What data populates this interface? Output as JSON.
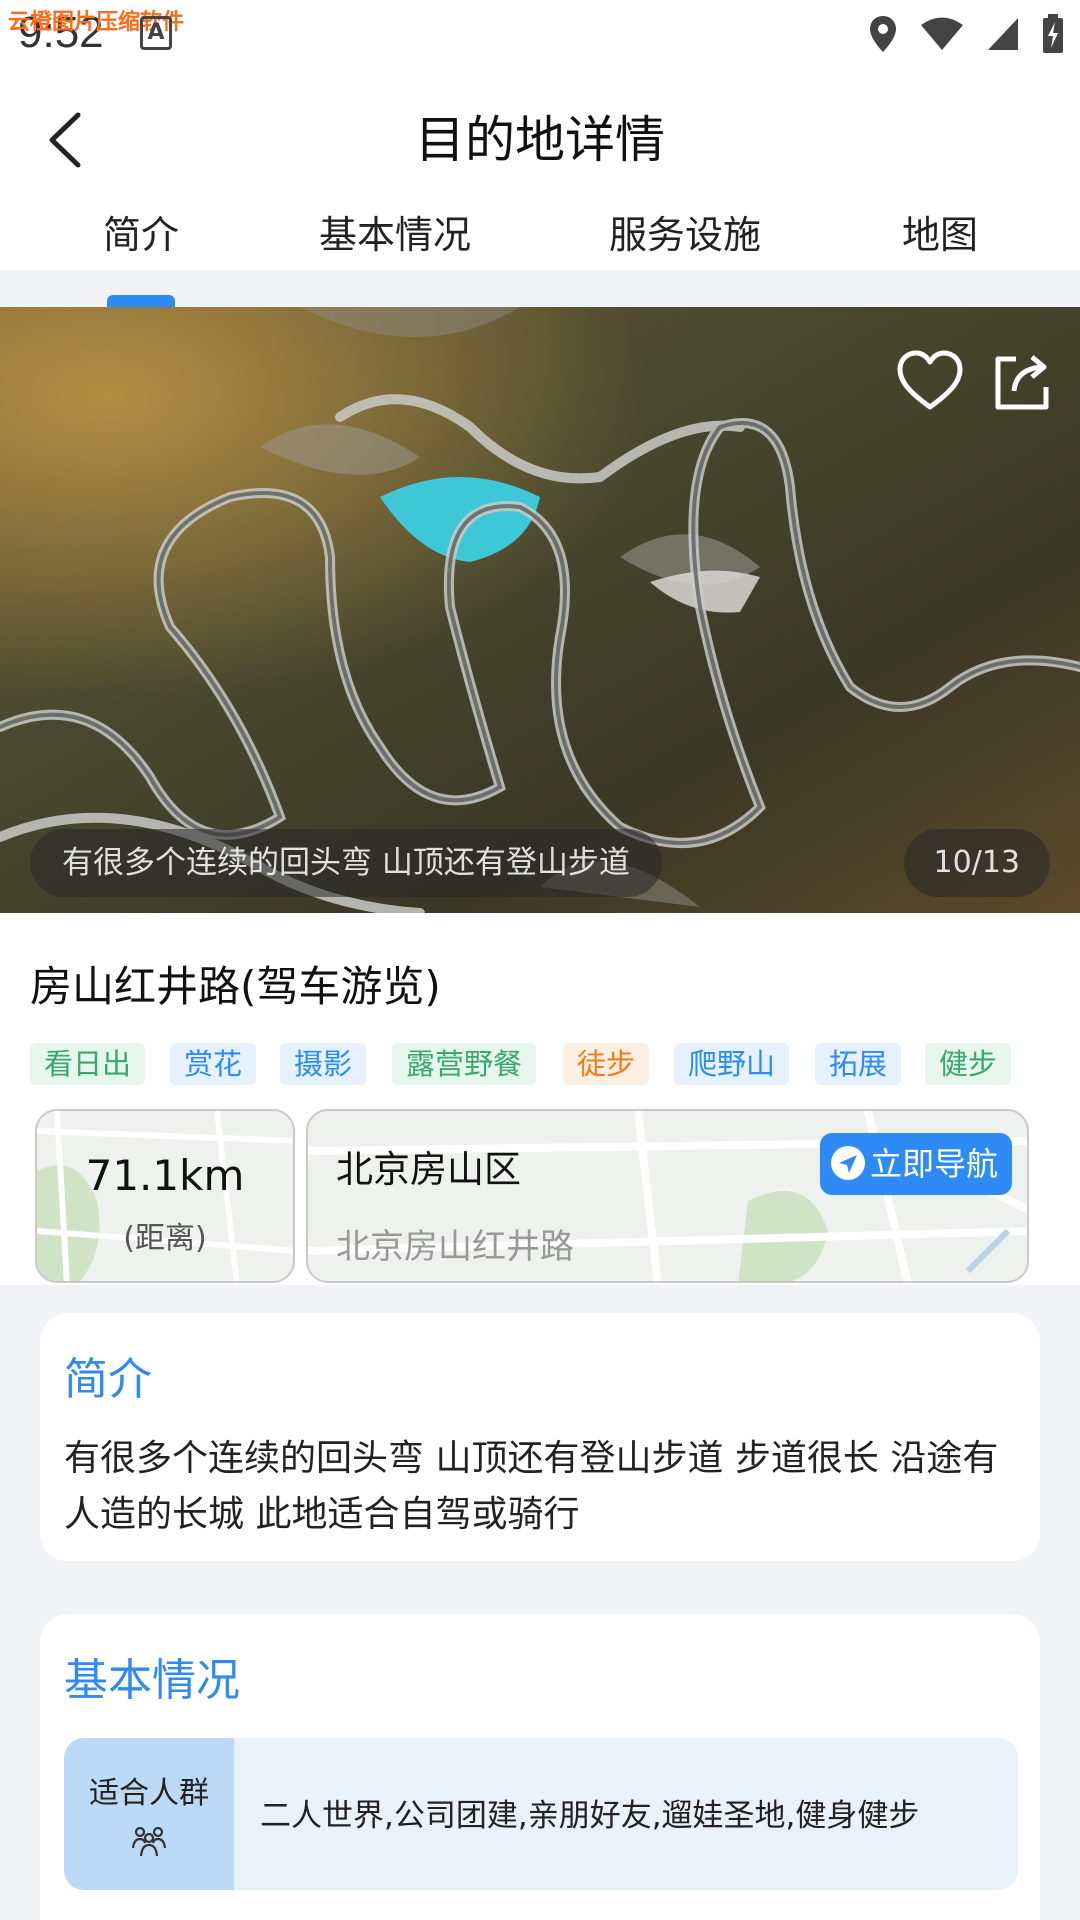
{
  "status_bar": {
    "time": "9:52",
    "watermark": "云橙图片压缩软件"
  },
  "header": {
    "title": "目的地详情"
  },
  "tabs": [
    {
      "label": "简介"
    },
    {
      "label": "基本情况"
    },
    {
      "label": "服务设施"
    },
    {
      "label": "地图"
    }
  ],
  "active_tab": "简介",
  "hero": {
    "caption": "有很多个连续的回头弯 山顶还有登山步道",
    "counter": "10/13"
  },
  "place": {
    "name": "房山红井路(驾车游览)",
    "tags": [
      {
        "label": "看日出",
        "color": "#3aa86a",
        "bg": "#e6f6ec"
      },
      {
        "label": "赏花",
        "color": "#2e8bf5",
        "bg": "#e5f1fd"
      },
      {
        "label": "摄影",
        "color": "#2e8bf5",
        "bg": "#e5f1fd"
      },
      {
        "label": "露营野餐",
        "color": "#3aa86a",
        "bg": "#e6f6ec"
      },
      {
        "label": "徒步",
        "color": "#f07a1c",
        "bg": "#fdefe2"
      },
      {
        "label": "爬野山",
        "color": "#2e8bf5",
        "bg": "#e5f1fd"
      },
      {
        "label": "拓展",
        "color": "#2e8bf5",
        "bg": "#e5f1fd"
      },
      {
        "label": "健步",
        "color": "#3aa86a",
        "bg": "#e6f6ec"
      }
    ],
    "distance": {
      "value": "71.1km",
      "label": "(距离)"
    },
    "address": {
      "city": "北京房山区",
      "street": "北京房山红井路",
      "nav_label": "立即导航"
    }
  },
  "intro": {
    "title": "简介",
    "text": "有很多个连续的回头弯 山顶还有登山步道 步道很长 沿途有人造的长城 此地适合自驾或骑行"
  },
  "basic": {
    "title": "基本情况",
    "crowd_label": "适合人群",
    "crowd_value": "二人世界,公司团建,亲朋好友,遛娃圣地,健身健步"
  },
  "colors": {
    "accent": "#2e8bf5"
  }
}
